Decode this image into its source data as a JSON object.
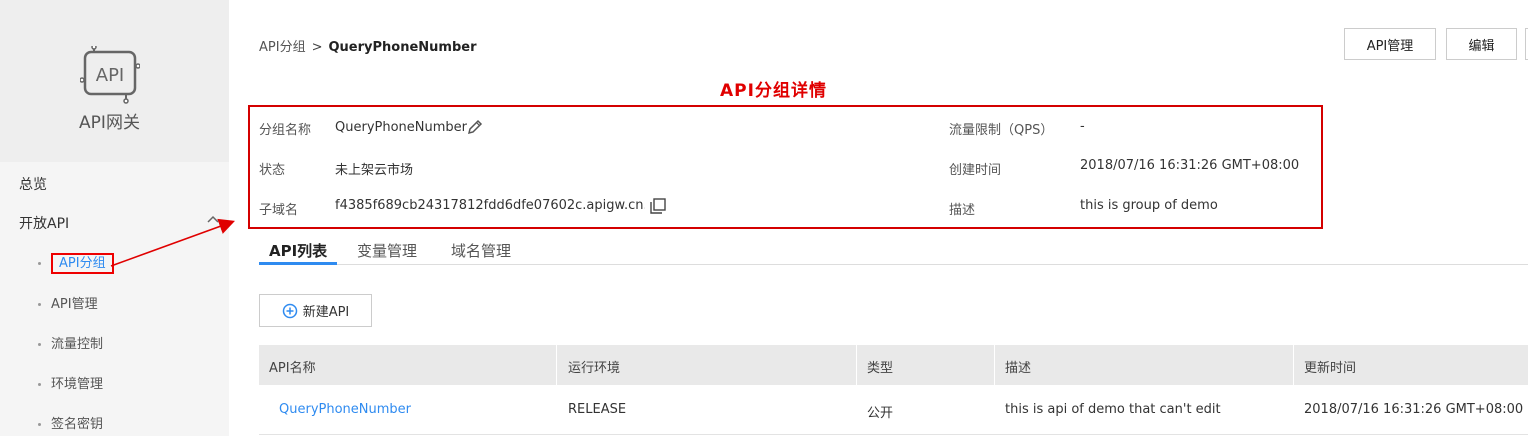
{
  "sidebar": {
    "brand_title": "API网关",
    "logo_text": "API",
    "overview": "总览",
    "open_api": "开放API",
    "items": [
      {
        "label": "API分组"
      },
      {
        "label": "API管理"
      },
      {
        "label": "流量控制"
      },
      {
        "label": "环境管理"
      },
      {
        "label": "签名密钥"
      }
    ]
  },
  "breadcrumb": {
    "parent": "API分组",
    "separator": ">",
    "current": "QueryPhoneNumber"
  },
  "header_buttons": {
    "api_manage": "API管理",
    "edit": "编辑"
  },
  "annotation": {
    "title": "API分组详情",
    "color": "#e00000"
  },
  "detail": {
    "group_name_label": "分组名称",
    "group_name_value": "QueryPhoneNumber",
    "status_label": "状态",
    "status_value": "未上架云市场",
    "subdomain_label": "子域名",
    "subdomain_value": "f4385f689cb24317812fdd6dfe07602c.apigw.cn...",
    "qps_label": "流量限制（QPS）",
    "qps_value": "-",
    "created_label": "创建时间",
    "created_value": "2018/07/16 16:31:26 GMT+08:00",
    "desc_label": "描述",
    "desc_value": "this is group of demo"
  },
  "tabs": [
    {
      "label": "API列表",
      "active": true
    },
    {
      "label": "变量管理",
      "active": false
    },
    {
      "label": "域名管理",
      "active": false
    }
  ],
  "new_api_button": "新建API",
  "table": {
    "columns": [
      "API名称",
      "运行环境",
      "类型",
      "描述",
      "更新时间"
    ],
    "rows": [
      [
        "QueryPhoneNumber",
        "RELEASE",
        "公开",
        "this is api of demo that can't edit",
        "2018/07/16 16:31:26 GMT+08:00"
      ]
    ]
  },
  "colors": {
    "accent": "#2f8bf0",
    "annotation_red": "#e00000"
  },
  "icons": {
    "logo": "api-logo-icon",
    "edit": "pencil-icon",
    "copy": "copy-icon",
    "add": "plus-circle-icon",
    "collapse": "chevron-up-icon"
  }
}
